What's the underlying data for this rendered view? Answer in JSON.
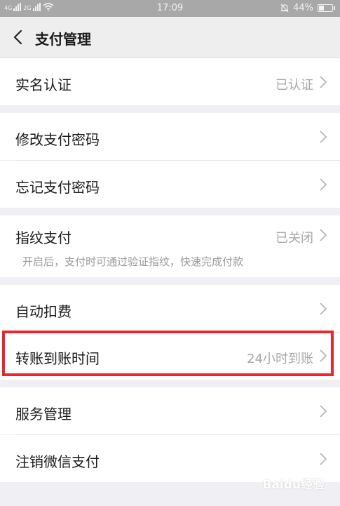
{
  "status_bar": {
    "carrier1": "4G",
    "carrier2": "2G",
    "time": "17:09",
    "battery": "44%",
    "battery_level": 0.44
  },
  "nav": {
    "title": "支付管理"
  },
  "items": [
    {
      "label": "实名认证",
      "value": "已认证"
    },
    {
      "label": "修改支付密码",
      "value": ""
    },
    {
      "label": "忘记支付密码",
      "value": ""
    },
    {
      "label": "指纹支付",
      "value": "已关闭",
      "description": "开启后，支付时可通过验证指纹，快速完成付款"
    },
    {
      "label": "自动扣费",
      "value": ""
    },
    {
      "label": "转账到账时间",
      "value": "24小时到账"
    },
    {
      "label": "服务管理",
      "value": ""
    },
    {
      "label": "注销微信支付",
      "value": ""
    }
  ],
  "watermark": "Baidu经验",
  "colors": {
    "highlight": "#e8262c",
    "background": "#efeff4",
    "status_bar": "#a8a8a8"
  },
  "icons": [
    "back-arrow-icon",
    "chevron-right-icon",
    "signal-icon",
    "wifi-icon",
    "alarm-icon",
    "battery-icon"
  ]
}
